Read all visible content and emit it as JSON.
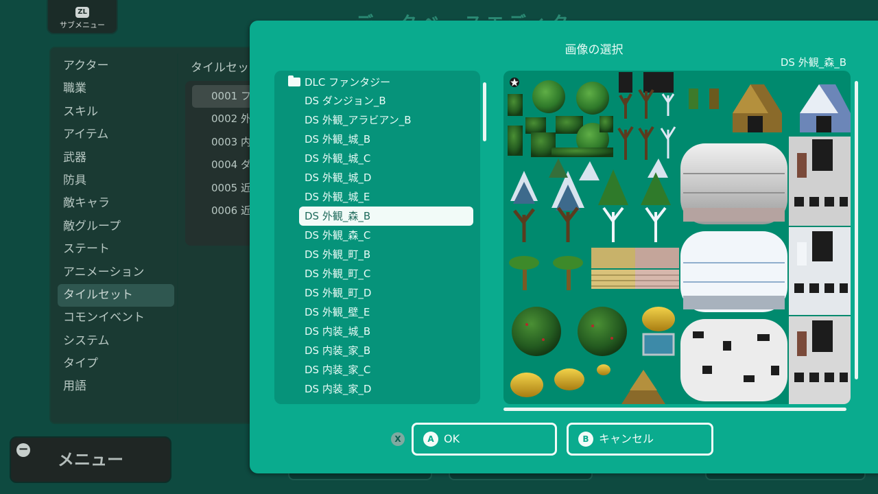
{
  "background": {
    "submenu_button": {
      "badge": "ZL",
      "label": "サブメニュー"
    },
    "title": "データベースエディタ",
    "db_menu": [
      {
        "label": "アクター"
      },
      {
        "label": "職業"
      },
      {
        "label": "スキル"
      },
      {
        "label": "アイテム"
      },
      {
        "label": "武器"
      },
      {
        "label": "防具"
      },
      {
        "label": "敵キャラ"
      },
      {
        "label": "敵グループ"
      },
      {
        "label": "ステート"
      },
      {
        "label": "アニメーション"
      },
      {
        "label": "タイルセット"
      },
      {
        "label": "コモンイベント"
      },
      {
        "label": "システム"
      },
      {
        "label": "タイプ"
      },
      {
        "label": "用語"
      }
    ],
    "db_menu_active": "タイルセット",
    "tileset_header": "タイルセッ",
    "tileset_items": [
      {
        "label": "0001 フ"
      },
      {
        "label": "0002 外"
      },
      {
        "label": "0003 内"
      },
      {
        "label": "0004 ダ"
      },
      {
        "label": "0005 近"
      },
      {
        "label": "0006 近"
      }
    ],
    "menu_button": {
      "badge": "−",
      "label": "メニュー"
    }
  },
  "dialog": {
    "title": "画像の選択",
    "selected_name": "DS 外観_森_B",
    "folder": "DLC ファンタジー",
    "files": [
      {
        "label": "DS ダンジョン_B"
      },
      {
        "label": "DS 外観_アラビアン_B"
      },
      {
        "label": "DS 外観_城_B"
      },
      {
        "label": "DS 外観_城_C"
      },
      {
        "label": "DS 外観_城_D"
      },
      {
        "label": "DS 外観_城_E"
      },
      {
        "label": "DS 外観_森_B"
      },
      {
        "label": "DS 外観_森_C"
      },
      {
        "label": "DS 外観_町_B"
      },
      {
        "label": "DS 外観_町_C"
      },
      {
        "label": "DS 外観_町_D"
      },
      {
        "label": "DS 外観_壁_E"
      },
      {
        "label": "DS 内装_城_B"
      },
      {
        "label": "DS 内装_家_B"
      },
      {
        "label": "DS 内装_家_C"
      },
      {
        "label": "DS 内装_家_D"
      }
    ],
    "selected_index": 6,
    "x_hint": "X",
    "ok_button": {
      "badge": "A",
      "label": "OK"
    },
    "cancel_button": {
      "badge": "B",
      "label": "キャンセル"
    }
  },
  "colors": {
    "background": "#0e4a40",
    "dialog": "#0aab8e",
    "list_panel": "#06937a",
    "preview_panel": "#008a6e",
    "selection": "#f2fbf8"
  }
}
